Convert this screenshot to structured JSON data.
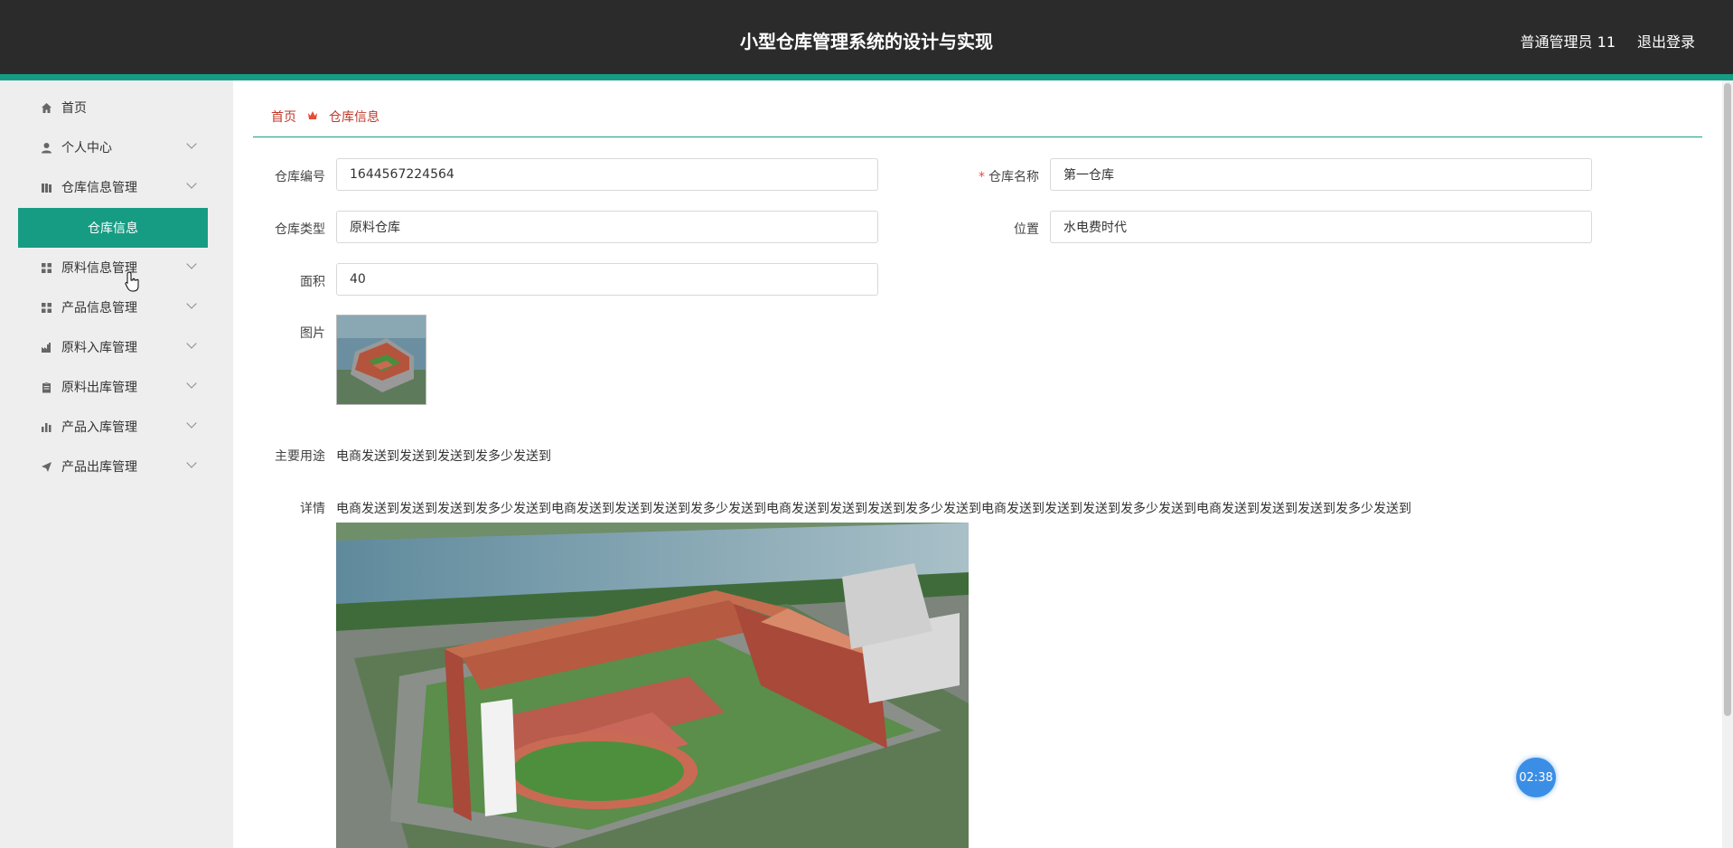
{
  "header": {
    "title": "小型仓库管理系统的设计与实现",
    "user": "普通管理员 11",
    "logout": "退出登录"
  },
  "sidebar": {
    "items": [
      {
        "label": "首页",
        "icon": "home-icon"
      },
      {
        "label": "个人中心",
        "icon": "user-icon"
      },
      {
        "label": "仓库信息管理",
        "icon": "library-icon"
      },
      {
        "label": "仓库信息",
        "icon": ""
      },
      {
        "label": "原料信息管理",
        "icon": "grid-icon"
      },
      {
        "label": "产品信息管理",
        "icon": "grid-icon"
      },
      {
        "label": "原料入库管理",
        "icon": "factory-icon"
      },
      {
        "label": "原料出库管理",
        "icon": "clipboard-icon"
      },
      {
        "label": "产品入库管理",
        "icon": "bar-chart-icon"
      },
      {
        "label": "产品出库管理",
        "icon": "send-icon"
      }
    ]
  },
  "breadcrumb": {
    "home": "首页",
    "current": "仓库信息"
  },
  "form": {
    "code_label": "仓库编号",
    "code_value": "1644567224564",
    "name_label": "仓库名称",
    "name_value": "第一仓库",
    "type_label": "仓库类型",
    "type_value": "原料仓库",
    "location_label": "位置",
    "location_value": "水电费时代",
    "area_label": "面积",
    "area_value": "40",
    "image_label": "图片",
    "usage_label": "主要用途",
    "usage_value": "电商发送到发送到发送到发多少发送到",
    "detail_label": "详情",
    "detail_value": "电商发送到发送到发送到发多少发送到电商发送到发送到发送到发多少发送到电商发送到发送到发送到发多少发送到电商发送到发送到发送到发多少发送到电商发送到发送到发送到发多少发送到"
  },
  "timer": "02:38",
  "colors": {
    "header_bg": "#2b2b2b",
    "accent": "#179c84",
    "sidebar_bg": "#eeeeee",
    "breadcrumb": "#c0392b"
  }
}
